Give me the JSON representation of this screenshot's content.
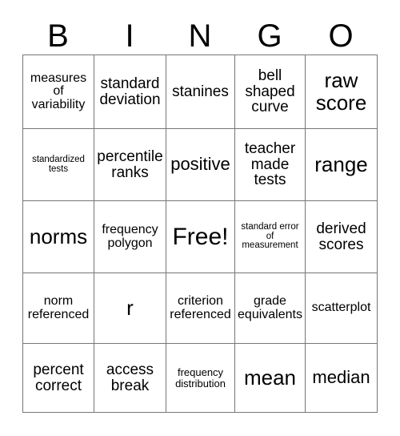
{
  "card": {
    "title": "BINGO",
    "header_letters": [
      "B",
      "I",
      "N",
      "G",
      "O"
    ],
    "columns": 5,
    "rows": 5,
    "free_space": {
      "row": 2,
      "column": 2,
      "label": "Free!"
    },
    "colors": {
      "background": "#ffffff",
      "text": "#000000",
      "grid_line": "#767676",
      "grid_outer_border": "#000000"
    },
    "grid": [
      [
        {
          "text": "measures of variability",
          "size": "s"
        },
        {
          "text": "standard deviation",
          "size": "m"
        },
        {
          "text": "stanines",
          "size": "m"
        },
        {
          "text": "bell shaped curve",
          "size": "m"
        },
        {
          "text": "raw score",
          "size": "xl"
        }
      ],
      [
        {
          "text": "standardized tests",
          "size": "xxs"
        },
        {
          "text": "percentile ranks",
          "size": "m"
        },
        {
          "text": "positive",
          "size": "l"
        },
        {
          "text": "teacher made tests",
          "size": "m"
        },
        {
          "text": "range",
          "size": "xl"
        }
      ],
      [
        {
          "text": "norms",
          "size": "xl"
        },
        {
          "text": "frequency polygon",
          "size": "s"
        },
        {
          "text": "Free!",
          "size": "xxl"
        },
        {
          "text": "standard error of measurement",
          "size": "xxs"
        },
        {
          "text": "derived scores",
          "size": "m"
        }
      ],
      [
        {
          "text": "norm referenced",
          "size": "s"
        },
        {
          "text": "r",
          "size": "xl"
        },
        {
          "text": "criterion referenced",
          "size": "s"
        },
        {
          "text": "grade equivalents",
          "size": "s"
        },
        {
          "text": "scatterplot",
          "size": "s"
        }
      ],
      [
        {
          "text": "percent correct",
          "size": "m"
        },
        {
          "text": "access break",
          "size": "m"
        },
        {
          "text": "frequency distribution",
          "size": "xs"
        },
        {
          "text": "mean",
          "size": "xl"
        },
        {
          "text": "median",
          "size": "l"
        }
      ]
    ]
  }
}
